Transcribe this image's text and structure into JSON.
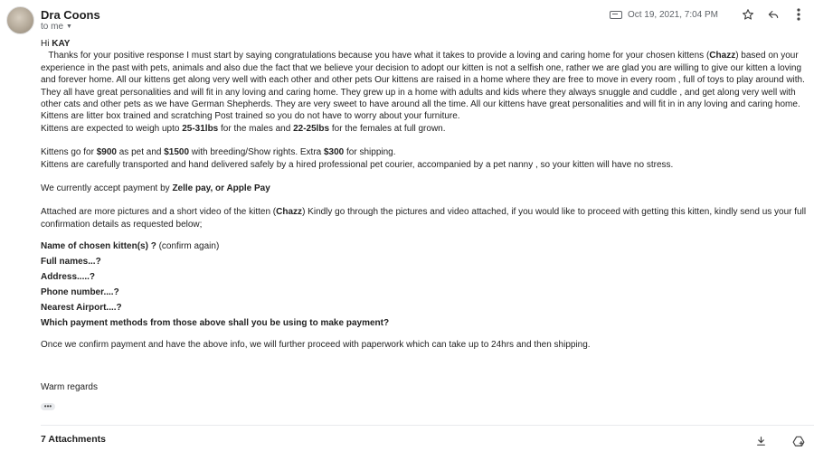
{
  "header": {
    "sender_name": "Dra Coons",
    "recipient": "to me",
    "date": "Oct 19, 2021, 7:04 PM"
  },
  "message": {
    "greeting_hi": "Hi",
    "greeting_name": "KAY",
    "p1": "Thanks for your positive response  I must start by saying congratulations because you have what it takes to provide a loving and caring home for your chosen kittens (",
    "p1_kitten": "Chazz",
    "p1_rest": ") based on your experience in the past with pets, animals  and also due the fact that we believe your decision to adopt our kitten is not a selfish one, rather we are glad you are willing to give our kitten a loving and forever home.  All our kittens get along very well with each other and other pets Our kittens are raised in a home  where they are free to move in every room , full of toys to play around with. They all have great personalities and will fit in any loving and caring home. They grew up in a home with adults and kids where they always snuggle and cuddle ,  and get along very well with other cats and other pets as we have German Shepherds. They are very sweet to have around all the time. All our kittens have great personalities and will fit in in any loving and caring home. Kittens are litter box  trained and scratching Post trained so you do not have to worry about your furniture.",
    "weight_pre": "Kittens are expected to weigh upto ",
    "weight_male": "25-31lbs",
    "weight_mid": " for the males and ",
    "weight_female": "22-25lbs",
    "weight_post": " for the females at full grown.",
    "price_pre": "Kittens go for ",
    "price_pet": "$900",
    "price_mid": " as pet and ",
    "price_breed": "$1500",
    "price_mid2": " with breeding/Show rights. Extra ",
    "price_ship": "$300",
    "price_post": "  for shipping.",
    "transport": "Kittens are carefully transported and hand delivered safely by a hired professional pet courier, accompanied by a pet nanny , so your kitten will have no stress.",
    "payment_pre": "We currently accept payment by ",
    "payment_methods": " Zelle pay, or  Apple Pay",
    "attached_pre": "Attached are more pictures and a short video  of the kitten (",
    "attached_kitten": "Chazz",
    "attached_post": ") Kindly go through the pictures and video attached, if you would like to proceed with getting this kitten, kindly send us your full confirmation details as requested below;",
    "q1": "Name of chosen kitten(s) ?",
    "q1_note": " (confirm again)",
    "q2": "Full names...?",
    "q3": "Address.....?",
    "q4": "Phone number....?",
    "q5": "Nearest Airport....?",
    "q6": "Which payment methods from those above shall you be using to make payment?",
    "closing_info": "Once we confirm payment and have the above info, we will further proceed with paperwork which can take up to 24hrs and then shipping.",
    "signoff": "Warm regards"
  },
  "attachments": {
    "label": "7 Attachments"
  },
  "icons": {
    "label": "label-icon",
    "star": "star-icon",
    "reply": "reply-icon",
    "more": "more-vert-icon",
    "download": "download-icon",
    "add_to_drive": "add-to-drive-icon"
  }
}
